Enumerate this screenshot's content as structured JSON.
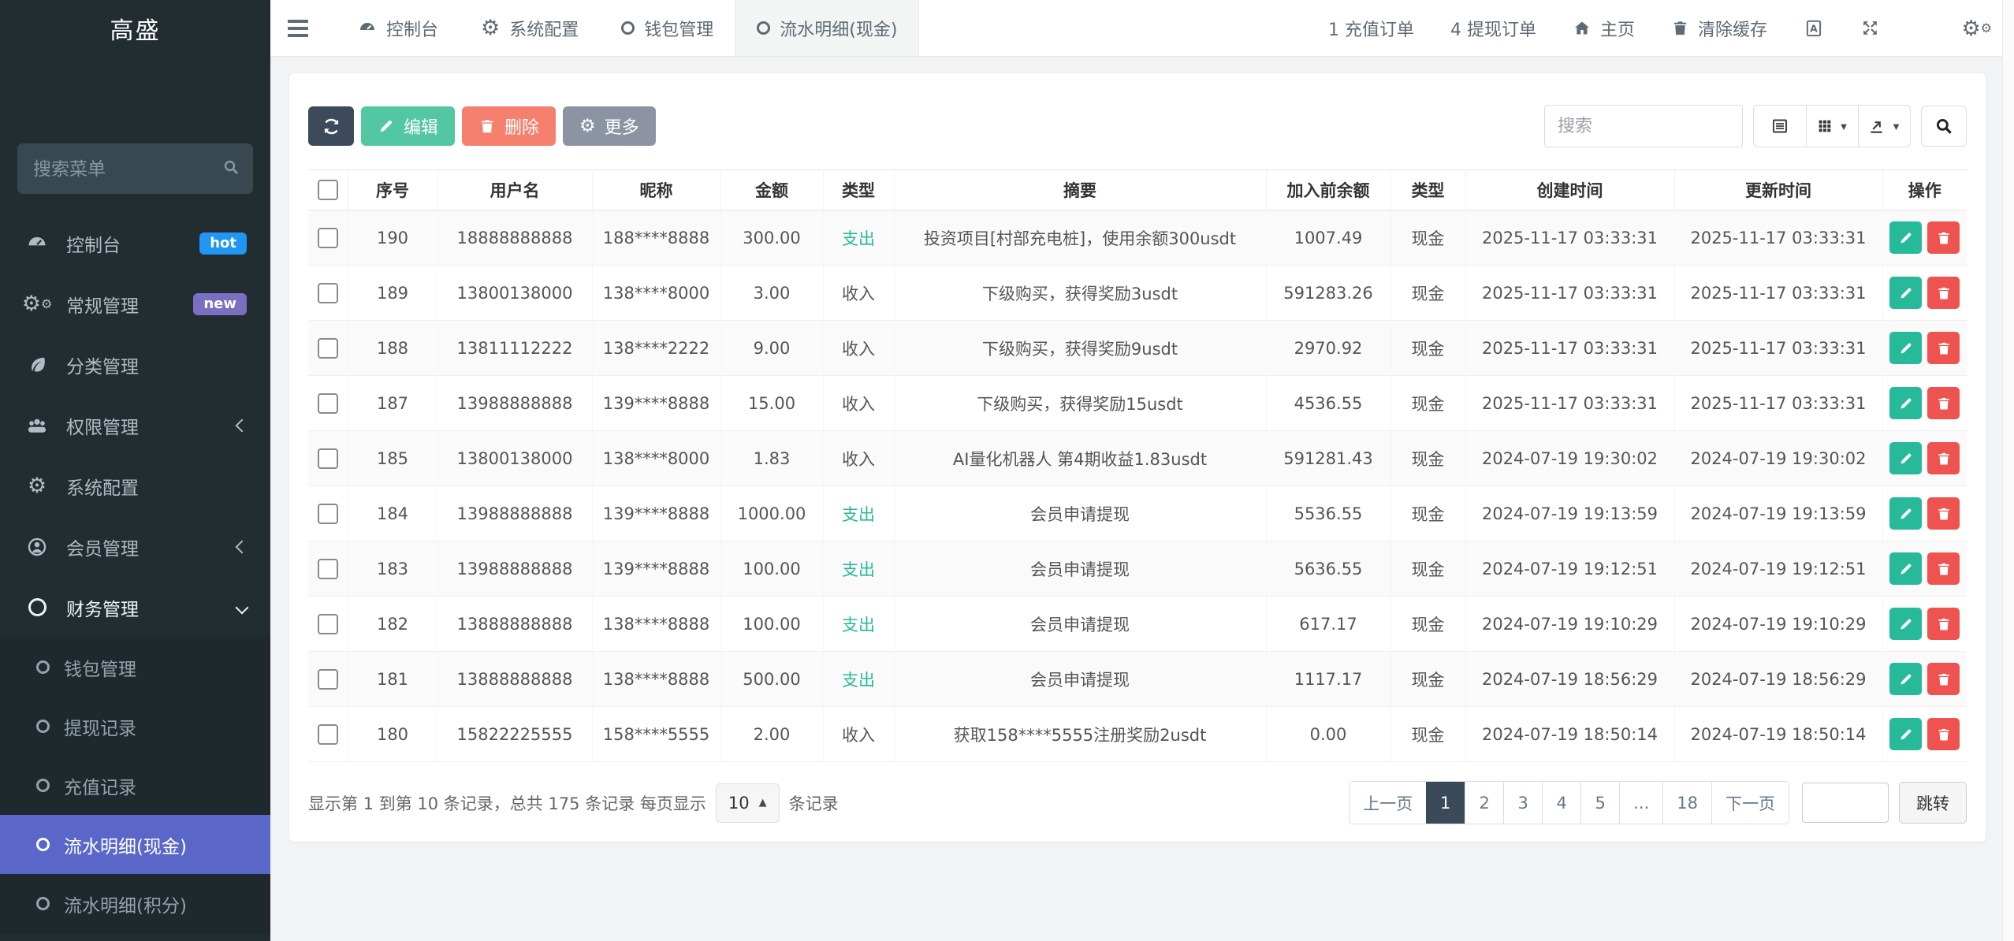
{
  "brand": {
    "title": "高盛"
  },
  "sidebar": {
    "search_placeholder": "搜索菜单",
    "items": [
      {
        "label": "控制台",
        "icon": "tachometer-icon",
        "badge": "hot"
      },
      {
        "label": "常规管理",
        "icon": "gears-icon",
        "badge": "new"
      },
      {
        "label": "分类管理",
        "icon": "leaf-icon"
      },
      {
        "label": "权限管理",
        "icon": "users-icon",
        "chevron": "left"
      },
      {
        "label": "系统配置",
        "icon": "gear-icon"
      },
      {
        "label": "会员管理",
        "icon": "user-icon",
        "chevron": "left"
      },
      {
        "label": "财务管理",
        "icon": "circle-icon",
        "chevron": "down",
        "expanded": true
      }
    ],
    "subitems": [
      {
        "label": "钱包管理",
        "active": false
      },
      {
        "label": "提现记录",
        "active": false
      },
      {
        "label": "充值记录",
        "active": false
      },
      {
        "label": "流水明细(现金)",
        "active": true
      },
      {
        "label": "流水明细(积分)",
        "active": false
      }
    ]
  },
  "topbar": {
    "tabs": [
      {
        "label": "控制台",
        "icon": "tachometer-icon",
        "active": false
      },
      {
        "label": "系统配置",
        "icon": "gear-icon",
        "active": false
      },
      {
        "label": "钱包管理",
        "icon": "circle-icon",
        "active": false
      },
      {
        "label": "流水明细(现金)",
        "icon": "circle-icon",
        "active": true
      }
    ],
    "recharge_orders": "1 充值订单",
    "withdraw_orders": "4 提现订单",
    "home_label": "主页",
    "clear_cache_label": "清除缓存"
  },
  "toolbar": {
    "edit_label": "编辑",
    "delete_label": "删除",
    "more_label": "更多",
    "search_placeholder": "搜索"
  },
  "table": {
    "columns": [
      "",
      "序号",
      "用户名",
      "昵称",
      "金额",
      "类型",
      "摘要",
      "加入前余额",
      "类型",
      "创建时间",
      "更新时间",
      "操作"
    ],
    "rows": [
      {
        "index": "190",
        "username": "18888888888",
        "nickname": "188****8888",
        "amount": "300.00",
        "type": "支出",
        "summary": "投资项目[村部充电桩]，使用余额300usdt",
        "balance": "1007.49",
        "category": "现金",
        "created": "2025-11-17 03:33:31",
        "updated": "2025-11-17 03:33:31"
      },
      {
        "index": "189",
        "username": "13800138000",
        "nickname": "138****8000",
        "amount": "3.00",
        "type": "收入",
        "summary": "下级购买，获得奖励3usdt",
        "balance": "591283.26",
        "category": "现金",
        "created": "2025-11-17 03:33:31",
        "updated": "2025-11-17 03:33:31"
      },
      {
        "index": "188",
        "username": "13811112222",
        "nickname": "138****2222",
        "amount": "9.00",
        "type": "收入",
        "summary": "下级购买，获得奖励9usdt",
        "balance": "2970.92",
        "category": "现金",
        "created": "2025-11-17 03:33:31",
        "updated": "2025-11-17 03:33:31"
      },
      {
        "index": "187",
        "username": "13988888888",
        "nickname": "139****8888",
        "amount": "15.00",
        "type": "收入",
        "summary": "下级购买，获得奖励15usdt",
        "balance": "4536.55",
        "category": "现金",
        "created": "2025-11-17 03:33:31",
        "updated": "2025-11-17 03:33:31"
      },
      {
        "index": "185",
        "username": "13800138000",
        "nickname": "138****8000",
        "amount": "1.83",
        "type": "收入",
        "summary": "AI量化机器人 第4期收益1.83usdt",
        "balance": "591281.43",
        "category": "现金",
        "created": "2024-07-19 19:30:02",
        "updated": "2024-07-19 19:30:02"
      },
      {
        "index": "184",
        "username": "13988888888",
        "nickname": "139****8888",
        "amount": "1000.00",
        "type": "支出",
        "summary": "会员申请提现",
        "balance": "5536.55",
        "category": "现金",
        "created": "2024-07-19 19:13:59",
        "updated": "2024-07-19 19:13:59"
      },
      {
        "index": "183",
        "username": "13988888888",
        "nickname": "139****8888",
        "amount": "100.00",
        "type": "支出",
        "summary": "会员申请提现",
        "balance": "5636.55",
        "category": "现金",
        "created": "2024-07-19 19:12:51",
        "updated": "2024-07-19 19:12:51"
      },
      {
        "index": "182",
        "username": "13888888888",
        "nickname": "138****8888",
        "amount": "100.00",
        "type": "支出",
        "summary": "会员申请提现",
        "balance": "617.17",
        "category": "现金",
        "created": "2024-07-19 19:10:29",
        "updated": "2024-07-19 19:10:29"
      },
      {
        "index": "181",
        "username": "13888888888",
        "nickname": "138****8888",
        "amount": "500.00",
        "type": "支出",
        "summary": "会员申请提现",
        "balance": "1117.17",
        "category": "现金",
        "created": "2024-07-19 18:56:29",
        "updated": "2024-07-19 18:56:29"
      },
      {
        "index": "180",
        "username": "15822225555",
        "nickname": "158****5555",
        "amount": "2.00",
        "type": "收入",
        "summary": "获取158****5555注册奖励2usdt",
        "balance": "0.00",
        "category": "现金",
        "created": "2024-07-19 18:50:14",
        "updated": "2024-07-19 18:50:14"
      }
    ]
  },
  "pagination": {
    "summary_prefix": "显示第 1 到第 10 条记录，总共 175 条记录 每页显示",
    "page_size": "10",
    "summary_suffix": "条记录",
    "prev_label": "上一页",
    "next_label": "下一页",
    "pages": [
      "1",
      "2",
      "3",
      "4",
      "5",
      "...",
      "18"
    ],
    "active_page": "1",
    "jump_label": "跳转",
    "jump_value": ""
  },
  "colors": {
    "sidebar_bg": "#222d32",
    "submenu_bg": "#1e282d",
    "active_menu": "#5a67c8",
    "badge_hot": "#2196f3",
    "badge_new": "#7a6fc0",
    "expense_text": "#26b99a",
    "btn_refresh": "#3d4a5c",
    "btn_edit": "#53c6a2",
    "btn_delete": "#f5806e",
    "btn_more": "#8c94a4",
    "row_edit_btn": "#26b99a",
    "row_delete_btn": "#ef5350",
    "pagination_active": "#3b4a5a"
  }
}
